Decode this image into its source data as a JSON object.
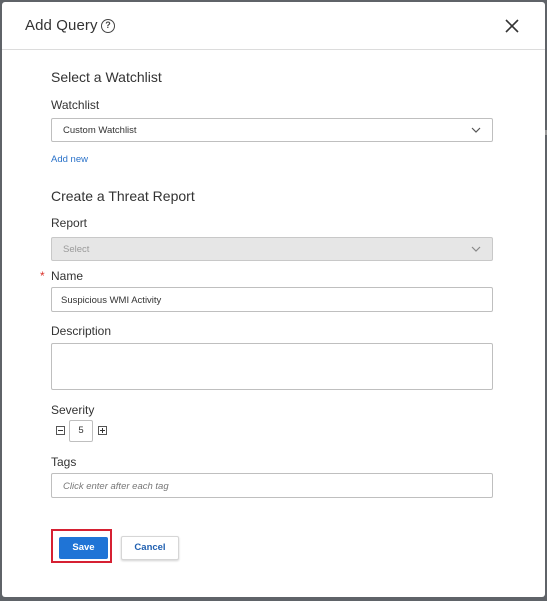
{
  "dialog": {
    "title": "Add Query",
    "help_icon": "help-circle-icon",
    "close_icon": "close-icon"
  },
  "watchlist_section": {
    "title": "Select a Watchlist",
    "label": "Watchlist",
    "selected": "Custom Watchlist",
    "add_new_link": "Add new"
  },
  "threat_report_section": {
    "title": "Create a Threat Report",
    "report": {
      "label": "Report",
      "placeholder": "Select",
      "disabled": true
    },
    "name": {
      "required_marker": "*",
      "label": "Name",
      "value": "Suspicious WMI Activity"
    },
    "description": {
      "label": "Description",
      "value": ""
    },
    "severity": {
      "label": "Severity",
      "value": "5",
      "decrement_icon": "minus-box-icon",
      "increment_icon": "plus-box-icon"
    },
    "tags": {
      "label": "Tags",
      "placeholder": "Click enter after each tag"
    }
  },
  "actions": {
    "save_label": "Save",
    "cancel_label": "Cancel"
  },
  "colors": {
    "primary": "#1f74d6",
    "link": "#2a72c9",
    "highlight_border": "#d62032",
    "required": "#d9322b"
  }
}
